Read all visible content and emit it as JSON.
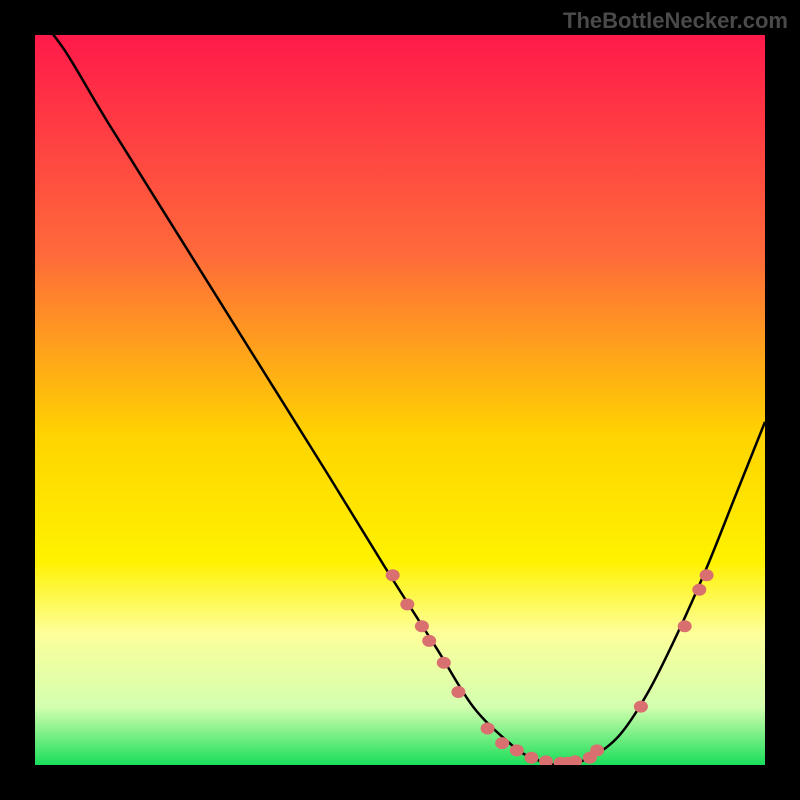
{
  "watermark": "TheBottleNecker.com",
  "chart_data": {
    "type": "line",
    "title": "",
    "xlabel": "",
    "ylabel": "",
    "xlim": [
      0,
      100
    ],
    "ylim": [
      0,
      100
    ],
    "gradient_stops": [
      {
        "offset": 0,
        "color": "#ff1a4a"
      },
      {
        "offset": 30,
        "color": "#ff6a3a"
      },
      {
        "offset": 55,
        "color": "#ffd400"
      },
      {
        "offset": 72,
        "color": "#fff200"
      },
      {
        "offset": 82,
        "color": "#fdff9a"
      },
      {
        "offset": 92,
        "color": "#d4ffb0"
      },
      {
        "offset": 100,
        "color": "#1ade5a"
      }
    ],
    "series": [
      {
        "name": "bottleneck-curve",
        "x": [
          0,
          4,
          10,
          20,
          30,
          40,
          48,
          55,
          60,
          65,
          68,
          72,
          76,
          80,
          84,
          88,
          92,
          96,
          100
        ],
        "y": [
          103,
          98,
          88,
          72,
          56,
          40,
          27,
          16,
          8,
          3,
          1,
          0,
          1,
          4,
          10,
          18,
          27,
          37,
          47
        ]
      }
    ],
    "markers": {
      "name": "data-points",
      "color": "#d96f6f",
      "points": [
        {
          "x": 49,
          "y": 26
        },
        {
          "x": 51,
          "y": 22
        },
        {
          "x": 53,
          "y": 19
        },
        {
          "x": 54,
          "y": 17
        },
        {
          "x": 56,
          "y": 14
        },
        {
          "x": 58,
          "y": 10
        },
        {
          "x": 62,
          "y": 5
        },
        {
          "x": 64,
          "y": 3
        },
        {
          "x": 66,
          "y": 2
        },
        {
          "x": 68,
          "y": 1
        },
        {
          "x": 70,
          "y": 0.5
        },
        {
          "x": 72,
          "y": 0.3
        },
        {
          "x": 73,
          "y": 0.3
        },
        {
          "x": 74,
          "y": 0.5
        },
        {
          "x": 76,
          "y": 1
        },
        {
          "x": 77,
          "y": 2
        },
        {
          "x": 83,
          "y": 8
        },
        {
          "x": 89,
          "y": 19
        },
        {
          "x": 91,
          "y": 24
        },
        {
          "x": 92,
          "y": 26
        }
      ]
    }
  }
}
